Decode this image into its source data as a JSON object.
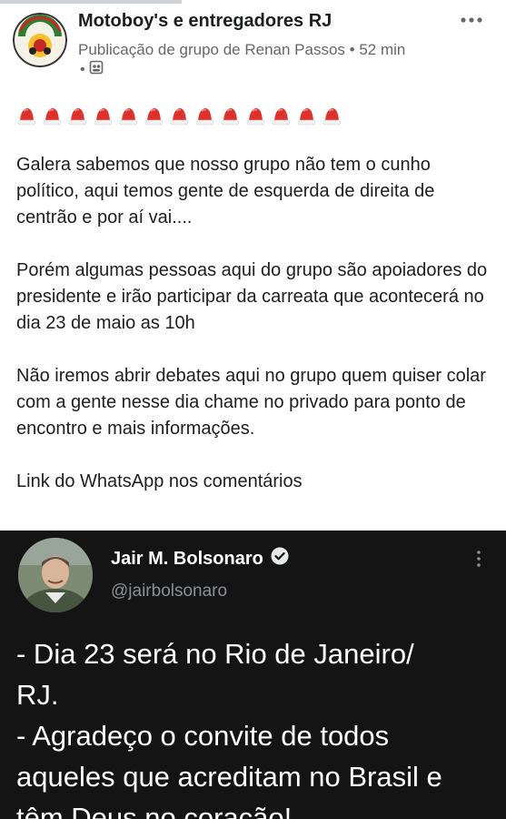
{
  "post": {
    "group_name": "Motoboy's e entregadores RJ",
    "meta": "Publicação de grupo de Renan Passos • 52 min",
    "meta_line2_dot": "•",
    "icons": {
      "more": "more-horizontal-icon",
      "audience": "members-icon",
      "hat": "christmas-hat-icon"
    },
    "hat_count": 13,
    "paragraphs": [
      "Galera sabemos que nosso grupo não tem o cunho político, aqui temos gente de esquerda de direita de centrão e por aí vai....",
      "Porém algumas pessoas aqui do grupo são apoiadores do presidente e irão participar da carreata que acontecerá no dia 23 de maio as 10h",
      "Não iremos abrir debates aqui no grupo quem quiser colar com a gente nesse dia chame no privado para ponto de encontro e mais informações.",
      "Link do WhatsApp nos comentários"
    ]
  },
  "tweet": {
    "name": "Jair M. Bolsonaro",
    "handle": "@jairbolsonaro",
    "lines": [
      "- Dia 23 será no Rio de Janeiro/",
      "RJ.",
      "- Agradeço o convite de todos",
      "aqueles que acreditam no Brasil e",
      "têm Deus no coração!"
    ],
    "icons": {
      "verified": "verified-badge-icon",
      "more": "more-vertical-icon"
    }
  },
  "colors": {
    "text": "#1c1e21",
    "secondary": "#65676b",
    "tweet_bg": "#141414",
    "tweet_handle": "#8b9095",
    "hat_red": "#e0302a"
  }
}
